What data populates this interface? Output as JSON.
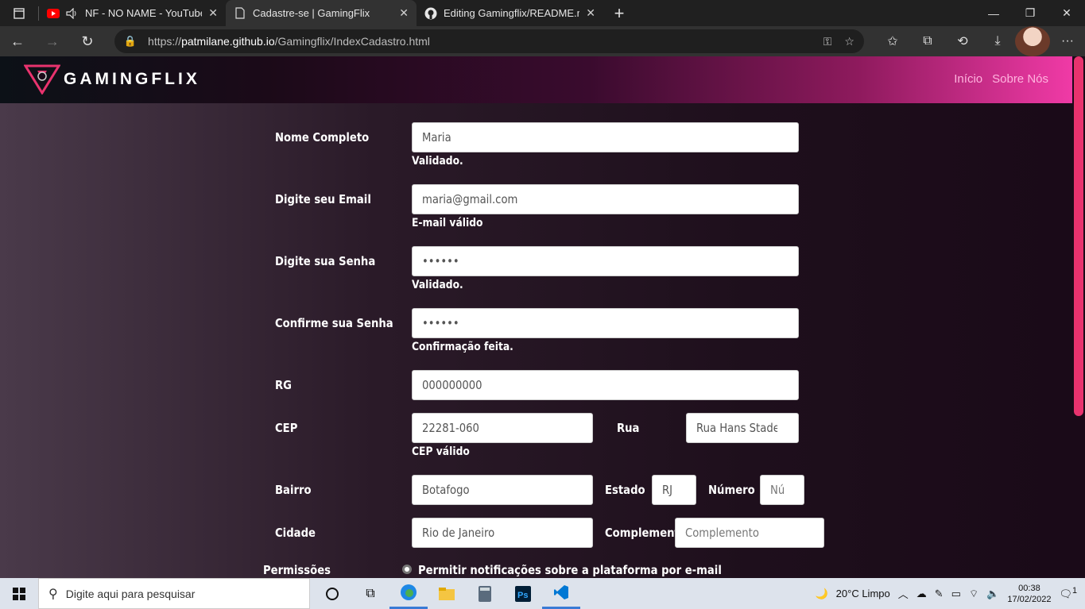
{
  "browser": {
    "tabs": [
      {
        "title": "NF - NO NAME - YouTube",
        "active": false
      },
      {
        "title": "Cadastre-se | GamingFlix",
        "active": true
      },
      {
        "title": "Editing Gamingflix/README.md",
        "active": false
      }
    ],
    "url_prefix": "https://",
    "url_host": "patmilane.github.io",
    "url_path": "/Gamingflix/IndexCadastro.html"
  },
  "site": {
    "logo_text": "GAMINGFLIX",
    "nav": [
      "Início",
      "Sobre Nós"
    ],
    "brand_color": "#e8336e"
  },
  "form": {
    "nome": {
      "label": "Nome Completo",
      "value": "Maria",
      "msg": "Validado."
    },
    "email": {
      "label": "Digite seu Email",
      "value": "maria@gmail.com",
      "msg": "E-mail válido"
    },
    "senha": {
      "label": "Digite sua Senha",
      "value": "••••••",
      "msg": "Validado."
    },
    "confirma": {
      "label": "Confirme sua Senha",
      "value": "••••••",
      "msg": "Confirmação feita."
    },
    "rg": {
      "label": "RG",
      "value": "000000000"
    },
    "cep": {
      "label": "CEP",
      "value": "22281-060",
      "msg": "CEP válido"
    },
    "rua": {
      "label": "Rua",
      "value": "Rua Hans Staden"
    },
    "bairro": {
      "label": "Bairro",
      "value": "Botafogo"
    },
    "estado": {
      "label": "Estado",
      "value": "RJ"
    },
    "numero": {
      "label": "Número",
      "placeholder": "Nú"
    },
    "cidade": {
      "label": "Cidade",
      "value": "Rio de Janeiro"
    },
    "complemento": {
      "label": "Complemento",
      "placeholder": "Complemento"
    },
    "permissoes": {
      "label": "Permissões",
      "option": "Permitir notificações sobre a plataforma por e-mail"
    }
  },
  "taskbar": {
    "search_placeholder": "Digite aqui para pesquisar",
    "weather": "20°C  Limpo",
    "time": "00:38",
    "date": "17/02/2022",
    "notifications": "1"
  }
}
